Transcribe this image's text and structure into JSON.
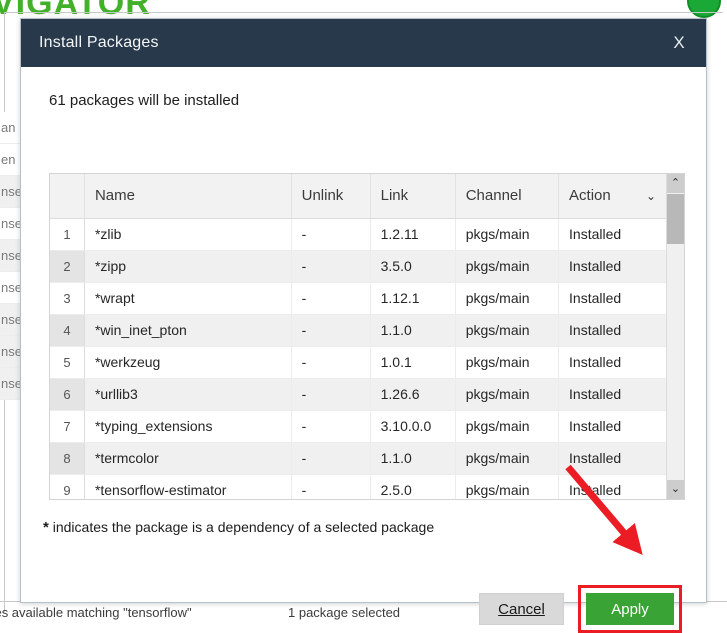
{
  "background": {
    "brand_text": "VIGATOR",
    "brand_color": "#43b02a",
    "status_left": "ages available matching \"tensorflow\"",
    "status_right": "1 package selected",
    "row_fragments": [
      "an",
      "en",
      "nse",
      "nse",
      "nse",
      "nse",
      "nse",
      "nse",
      "nse"
    ]
  },
  "dialog": {
    "title": "Install Packages",
    "close_label": "X",
    "summary": "61 packages will be installed",
    "titlebar_color": "#27394a",
    "table": {
      "columns": [
        "",
        "Name",
        "Unlink",
        "Link",
        "Channel",
        "Action"
      ],
      "action_caret": "⌄",
      "rows": [
        {
          "index": "1",
          "name": "*zlib",
          "unlink": "-",
          "link": "1.2.11",
          "channel": "pkgs/main",
          "action": "Installed"
        },
        {
          "index": "2",
          "name": "*zipp",
          "unlink": "-",
          "link": "3.5.0",
          "channel": "pkgs/main",
          "action": "Installed"
        },
        {
          "index": "3",
          "name": "*wrapt",
          "unlink": "-",
          "link": "1.12.1",
          "channel": "pkgs/main",
          "action": "Installed"
        },
        {
          "index": "4",
          "name": "*win_inet_pton",
          "unlink": "-",
          "link": "1.1.0",
          "channel": "pkgs/main",
          "action": "Installed"
        },
        {
          "index": "5",
          "name": "*werkzeug",
          "unlink": "-",
          "link": "1.0.1",
          "channel": "pkgs/main",
          "action": "Installed"
        },
        {
          "index": "6",
          "name": "*urllib3",
          "unlink": "-",
          "link": "1.26.6",
          "channel": "pkgs/main",
          "action": "Installed"
        },
        {
          "index": "7",
          "name": "*typing_extensions",
          "unlink": "-",
          "link": "3.10.0.0",
          "channel": "pkgs/main",
          "action": "Installed"
        },
        {
          "index": "8",
          "name": "*termcolor",
          "unlink": "-",
          "link": "1.1.0",
          "channel": "pkgs/main",
          "action": "Installed"
        },
        {
          "index": "9",
          "name": "*tensorflow-estimator",
          "unlink": "-",
          "link": "2.5.0",
          "channel": "pkgs/main",
          "action": "Installed"
        }
      ]
    },
    "scrollbar": {
      "up_arrow": "⌃",
      "down_arrow": "⌄"
    },
    "dependency_note_star": "*",
    "dependency_note": " indicates the package is a dependency of a selected package",
    "buttons": {
      "cancel_label": "Cancel",
      "apply_label": "Apply",
      "apply_color": "#3aa335",
      "highlight_color": "#ec1c24"
    }
  }
}
